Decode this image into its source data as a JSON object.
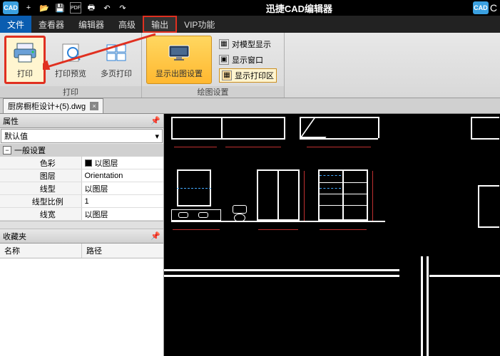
{
  "title": "迅捷CAD编辑器",
  "logo": "CAD",
  "right_logo_text": "C",
  "qat": {
    "new": "+",
    "open": "📂",
    "save": "💾",
    "pdf": "PDF",
    "print": "🖶",
    "undo": "↶",
    "redo": "↷"
  },
  "menu": {
    "file": "文件",
    "viewer": "查看器",
    "editor": "编辑器",
    "adv": "高级",
    "output": "输出",
    "vip": "VIP功能"
  },
  "ribbon": {
    "print_group": "打印",
    "plot_group": "绘图设置",
    "print": "打印",
    "preview": "打印预览",
    "multi": "多页打印",
    "showcfg": "显示出图设置",
    "model": "对模型显示",
    "window": "显示窗口",
    "printarea": "显示打印区"
  },
  "doc_tab": "厨房橱柜设计+(5).dwg",
  "panels": {
    "props": "属性",
    "default": "默认值",
    "favs": "收藏夹",
    "name": "名称",
    "path": "路径"
  },
  "props": {
    "section": "一般设置",
    "rows": [
      {
        "name": "色彩",
        "val": "以图层",
        "swatch": true
      },
      {
        "name": "图层",
        "val": "Orientation"
      },
      {
        "name": "线型",
        "val": "以图层"
      },
      {
        "name": "线型比例",
        "val": "1"
      },
      {
        "name": "线宽",
        "val": "以图层"
      }
    ]
  }
}
